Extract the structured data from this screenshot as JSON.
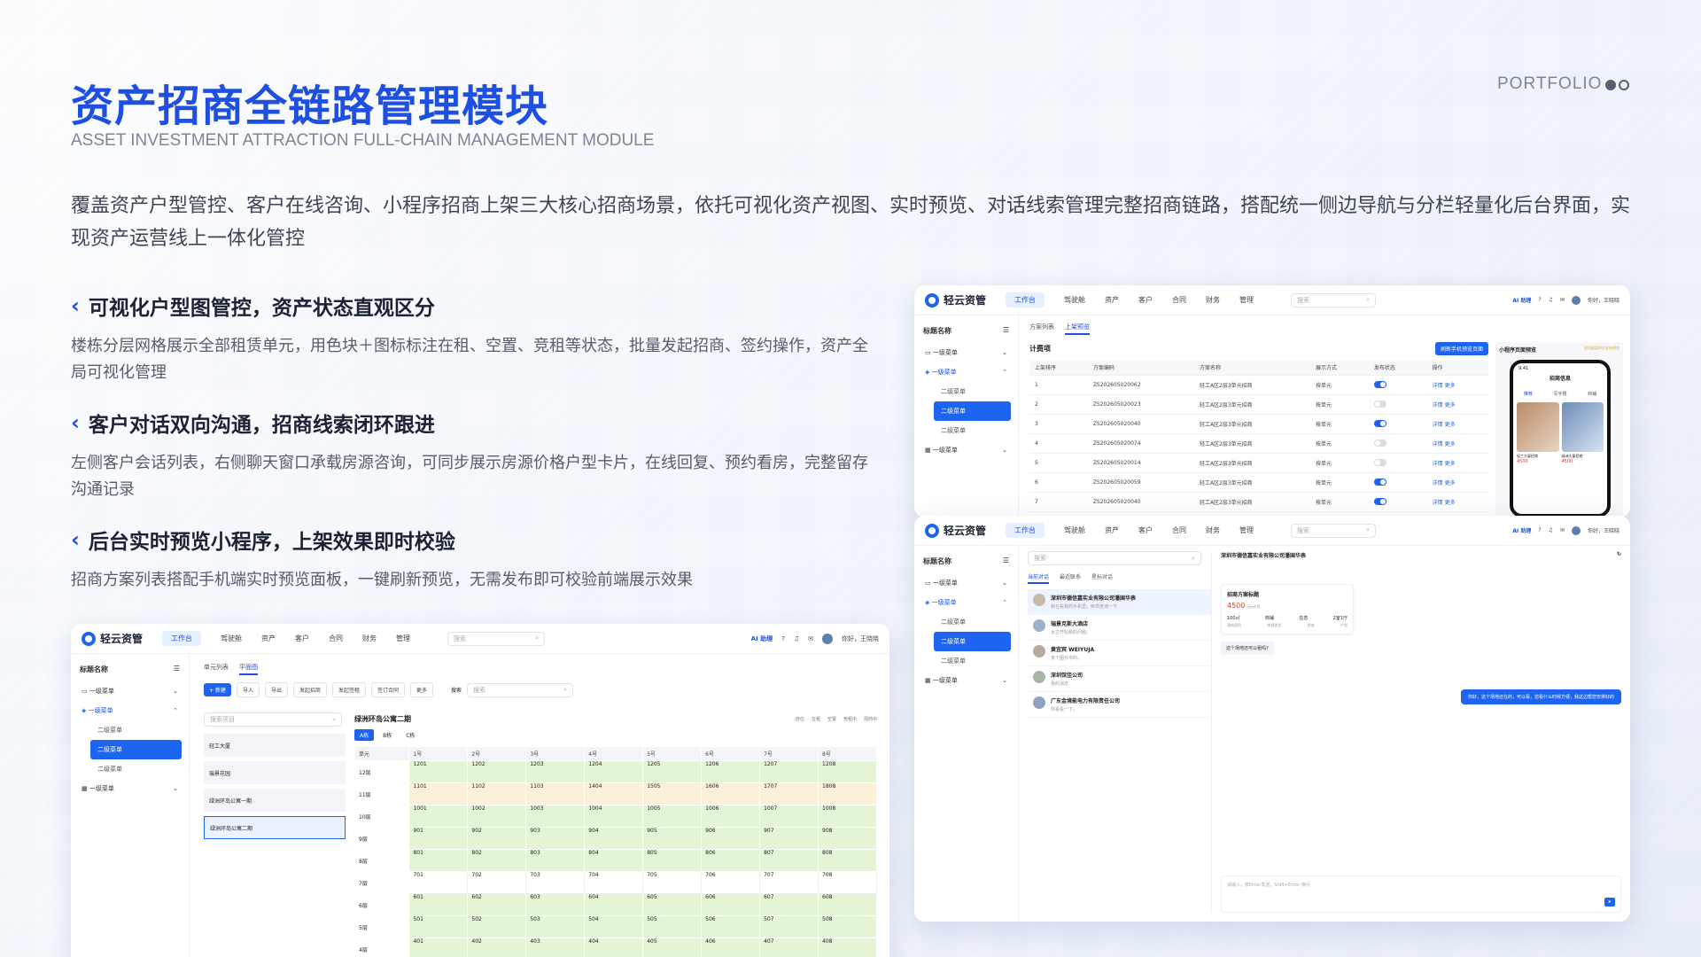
{
  "header": {
    "title": "资产招商全链路管理模块",
    "subtitle": "ASSET INVESTMENT ATTRACTION FULL-CHAIN MANAGEMENT MODULE",
    "portfolio": "PORTFOLIO",
    "intro": "覆盖资产户型管控、客户在线咨询、小程序招商上架三大核心招商场景，依托可视化资产视图、实时预览、对话线索管理完整招商链路，搭配统一侧边导航与分栏轻量化后台界面，实现资产运营线上一体化管控"
  },
  "features": [
    {
      "title": "可视化户型图管控，资产状态直观区分",
      "desc": "楼栋分层网格展示全部租赁单元，用色块＋图标标注在租、空置、竞租等状态，批量发起招商、签约操作，资产全局可视化管理"
    },
    {
      "title": "客户对话双向沟通，招商线索闭环跟进",
      "desc": "左侧客户会话列表，右侧聊天窗口承载房源咨询，可同步展示房源价格户型卡片，在线回复、预约看房，完整留存沟通记录"
    },
    {
      "title": "后台实时预览小程序，上架效果即时校验",
      "desc": "招商方案列表搭配手机端实时预览面板，一键刷新预览，无需发布即可校验前端展示效果"
    }
  ],
  "app": {
    "logo": "轻云资管",
    "nav": [
      "工作台",
      "驾驶舱",
      "资产",
      "客户",
      "合同",
      "财务",
      "管理"
    ],
    "search_placeholder": "搜索",
    "ai_label": "助理",
    "user": "你好，王晓晓",
    "side_title": "标题名称",
    "menu_l1": "一级菜单",
    "menu_l2": "二级菜单"
  },
  "grid_window": {
    "tabs": [
      "单元列表",
      "平面图"
    ],
    "actions": [
      "+ 新建",
      "导入",
      "导出",
      "发起招商",
      "发起签租",
      "签订合同",
      "更多"
    ],
    "search_label": "搜索",
    "building_search": "搜索项目",
    "buildings": [
      "轻工大厦",
      "瑞景花园",
      "绿洲环岛公寓一期",
      "绿洲环岛公寓二期"
    ],
    "project_title": "绿洲环岛公寓二期",
    "blocks": [
      "A栋",
      "B栋",
      "C栋"
    ],
    "legend": [
      "自住",
      "在租",
      "空置",
      "竞租中",
      "招商中"
    ],
    "columns": [
      "单元",
      "1号",
      "2号",
      "3号",
      "4号",
      "5号",
      "6号",
      "7号",
      "8号"
    ],
    "floors": [
      "12层",
      "11层",
      "10层",
      "9层",
      "8层",
      "7层",
      "6层",
      "5层",
      "4层"
    ],
    "rows": [
      [
        "1201",
        "1202",
        "1203",
        "1204",
        "1205",
        "1206",
        "1207",
        "1208"
      ],
      [
        "1101",
        "1102",
        "1103",
        "1404",
        "1505",
        "1606",
        "1707",
        "1808"
      ],
      [
        "1001",
        "1002",
        "1003",
        "1004",
        "1005",
        "1006",
        "1007",
        "1008"
      ],
      [
        "901",
        "902",
        "903",
        "904",
        "905",
        "906",
        "907",
        "908"
      ],
      [
        "801",
        "802",
        "803",
        "804",
        "805",
        "806",
        "807",
        "808"
      ],
      [
        "701",
        "702",
        "703",
        "704",
        "705",
        "706",
        "707",
        "708"
      ],
      [
        "601",
        "602",
        "603",
        "604",
        "605",
        "606",
        "607",
        "608"
      ],
      [
        "501",
        "502",
        "503",
        "504",
        "505",
        "506",
        "507",
        "508"
      ],
      [
        "401",
        "402",
        "403",
        "404",
        "405",
        "406",
        "407",
        "408"
      ]
    ]
  },
  "plan_window": {
    "tabs": [
      "方案列表",
      "上架预览"
    ],
    "section_title": "计费项",
    "refresh_button": "刷新手机预览页面",
    "preview_title": "小程序页面预览",
    "preview_hint": "该功能暂时仅支持预览",
    "columns": [
      "上架排序",
      "方案编码",
      "方案名称",
      "展示方式",
      "发布状态",
      "操作"
    ],
    "rows": [
      [
        "1",
        "ZS202605020062",
        "轻工A区2层3单元招商",
        "按单元",
        "on"
      ],
      [
        "2",
        "ZS202605020023",
        "轻工A区2层3单元招商",
        "按单元",
        "off"
      ],
      [
        "3",
        "ZS202605020040",
        "轻工A区2层3单元招商",
        "按单元",
        "on"
      ],
      [
        "4",
        "ZS202605020074",
        "轻工A区2层3单元招商",
        "按单元",
        "off"
      ],
      [
        "5",
        "ZS202605020014",
        "轻工A区2层3单元招商",
        "按单元",
        "off"
      ],
      [
        "6",
        "ZS202605020059",
        "轻工A区2层3单元招商",
        "按单元",
        "on"
      ],
      [
        "7",
        "ZS202605020040",
        "轻工A区2层3单元招商",
        "按单元",
        "on"
      ]
    ],
    "ops": "详情  更多",
    "phone": {
      "time": "9:41",
      "title": "招商信息",
      "tabs": [
        "推荐",
        "写字楼",
        "商铺"
      ],
      "card1": {
        "name": "轻工大厦招商",
        "price": "4500"
      },
      "card2": {
        "name": "绿洲大厦招商",
        "price": "4500"
      }
    }
  },
  "chat_window": {
    "side_search": "搜索",
    "tabs": [
      "当前对话",
      "最近联系",
      "星标对话"
    ],
    "conversations": [
      {
        "name": "深圳市德信嘉实业有限公司潘国华表",
        "msg": "我在看我的手机里，麻烦咨询一下"
      },
      {
        "name": "瑞景克斯大酒店",
        "msg": "太古开始新的问题。"
      },
      {
        "name": "黄宜宾 WEIYUJA",
        "msg": "有个图片中的。"
      },
      {
        "name": "深圳馆佳公司",
        "msg": "我的消息"
      },
      {
        "name": "广东金境能电力有限责任公司",
        "msg": "你看看一下。"
      }
    ],
    "chat_title": "深圳市德信嘉实业有限公司潘国华表",
    "card_title": "招商方案标题",
    "card_price": "4500",
    "card_unit": "元/㎡·月",
    "card_specs": [
      "100㎡",
      "商铺",
      "在态",
      "2室1厅"
    ],
    "card_spec_labels": [
      "建筑面积",
      "房源类型",
      "状态",
      "户型"
    ],
    "msg_in": "这个场地还可以租吗?",
    "msg_out": "你好，这个场地还在的，可以看，您看什么时候方便，我这边帮您安排好的",
    "input_placeholder": "请输入，按Enter发送，Shift+Enter 换行"
  }
}
